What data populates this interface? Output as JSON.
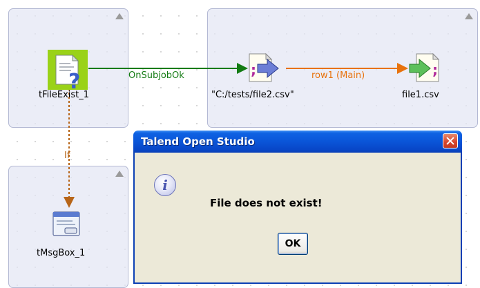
{
  "canvas": {
    "subjobs": [
      "subjob-file-exist",
      "subjob-file-input",
      "subjob-msgbox"
    ],
    "components": {
      "file_exist": {
        "label": "tFileExist_1",
        "icon": "file-exist-icon"
      },
      "file_input": {
        "label": "\"C:/tests/file2.csv\"",
        "icon": "file-input-csv-icon"
      },
      "file_output": {
        "label": "file1.csv",
        "icon": "file-output-csv-icon"
      },
      "msgbox": {
        "label": "tMsgBox_1",
        "icon": "message-box-icon"
      }
    },
    "links": {
      "on_subjob_ok": "OnSubjobOk",
      "row_main": "row1 (Main)",
      "if_trigger": "If"
    },
    "colors": {
      "subjob_bg": "#e3e6f4",
      "on_subjob_ok_link": "#137b13",
      "row_link": "#e8720c",
      "if_link": "#b76518"
    }
  },
  "dialog": {
    "title": "Talend Open Studio",
    "message": "File does not exist!",
    "ok_label": "OK",
    "icon": "info-icon",
    "close_icon": "close-icon"
  }
}
